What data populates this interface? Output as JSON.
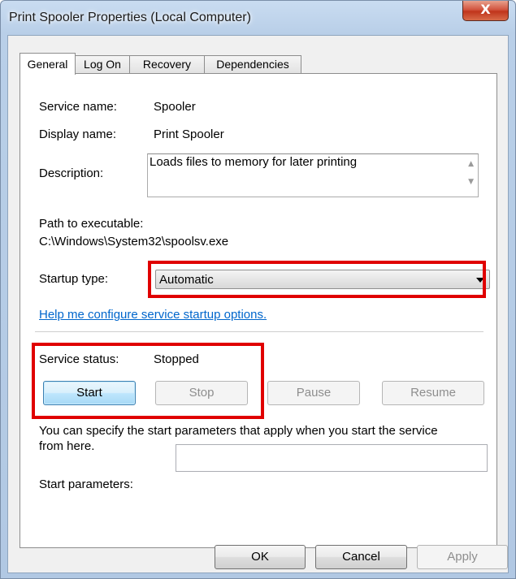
{
  "window": {
    "title": "Print Spooler Properties (Local Computer)",
    "close_glyph": "X"
  },
  "tabs": [
    {
      "label": "General",
      "active": true
    },
    {
      "label": "Log On",
      "active": false
    },
    {
      "label": "Recovery",
      "active": false
    },
    {
      "label": "Dependencies",
      "active": false
    }
  ],
  "general": {
    "service_name_label": "Service name:",
    "service_name_value": "Spooler",
    "display_name_label": "Display name:",
    "display_name_value": "Print Spooler",
    "description_label": "Description:",
    "description_value": "Loads files to memory for later printing",
    "path_label": "Path to executable:",
    "path_value": "C:\\Windows\\System32\\spoolsv.exe",
    "startup_type_label": "Startup type:",
    "startup_type_value": "Automatic",
    "help_link": "Help me configure service startup options.",
    "service_status_label": "Service status:",
    "service_status_value": "Stopped",
    "buttons": {
      "start": "Start",
      "stop": "Stop",
      "pause": "Pause",
      "resume": "Resume"
    },
    "hint_text_line1": "You can specify the start parameters that apply when you start the service",
    "hint_text_line2": "from here.",
    "start_params_label": "Start parameters:",
    "start_params_value": ""
  },
  "dialog_buttons": {
    "ok": "OK",
    "cancel": "Cancel",
    "apply": "Apply"
  },
  "colors": {
    "highlight": "#e00000",
    "link": "#0066cc",
    "close_button": "#c0341c"
  }
}
